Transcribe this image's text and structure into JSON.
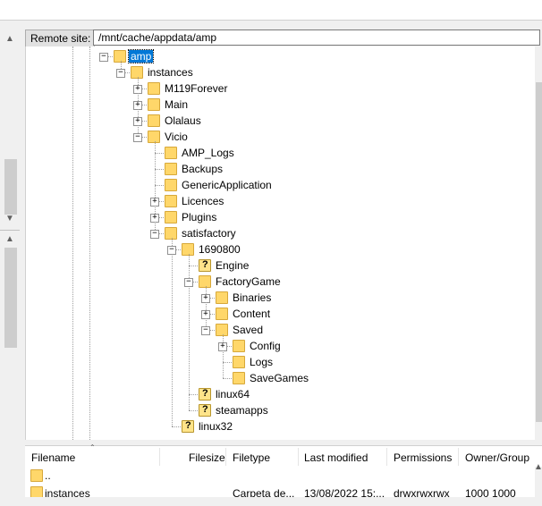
{
  "remote": {
    "label": "Remote site:",
    "path": "/mnt/cache/appdata/amp"
  },
  "tree": [
    {
      "label": "amp",
      "depth": 0,
      "exp": "-",
      "type": "folder",
      "selected": true
    },
    {
      "label": "instances",
      "depth": 1,
      "exp": "-",
      "type": "folder"
    },
    {
      "label": "M119Forever",
      "depth": 2,
      "exp": "+",
      "type": "folder"
    },
    {
      "label": "Main",
      "depth": 2,
      "exp": "+",
      "type": "folder"
    },
    {
      "label": "Olalaus",
      "depth": 2,
      "exp": "+",
      "type": "folder"
    },
    {
      "label": "Vicio",
      "depth": 2,
      "exp": "-",
      "type": "folder"
    },
    {
      "label": "AMP_Logs",
      "depth": 3,
      "exp": "",
      "type": "folder"
    },
    {
      "label": "Backups",
      "depth": 3,
      "exp": "",
      "type": "folder"
    },
    {
      "label": "GenericApplication",
      "depth": 3,
      "exp": "",
      "type": "folder"
    },
    {
      "label": "Licences",
      "depth": 3,
      "exp": "+",
      "type": "folder"
    },
    {
      "label": "Plugins",
      "depth": 3,
      "exp": "+",
      "type": "folder"
    },
    {
      "label": "satisfactory",
      "depth": 3,
      "exp": "-",
      "type": "folder"
    },
    {
      "label": "1690800",
      "depth": 4,
      "exp": "-",
      "type": "folder"
    },
    {
      "label": "Engine",
      "depth": 5,
      "exp": "",
      "type": "unknown"
    },
    {
      "label": "FactoryGame",
      "depth": 5,
      "exp": "-",
      "type": "folder"
    },
    {
      "label": "Binaries",
      "depth": 6,
      "exp": "+",
      "type": "folder"
    },
    {
      "label": "Content",
      "depth": 6,
      "exp": "+",
      "type": "folder"
    },
    {
      "label": "Saved",
      "depth": 6,
      "exp": "-",
      "type": "folder"
    },
    {
      "label": "Config",
      "depth": 7,
      "exp": "+",
      "type": "folder"
    },
    {
      "label": "Logs",
      "depth": 7,
      "exp": "",
      "type": "folder"
    },
    {
      "label": "SaveGames",
      "depth": 7,
      "exp": "",
      "type": "folder"
    },
    {
      "label": "linux64",
      "depth": 5,
      "exp": "",
      "type": "unknown"
    },
    {
      "label": "steamapps",
      "depth": 5,
      "exp": "",
      "type": "unknown"
    },
    {
      "label": "linux32",
      "depth": 4,
      "exp": "",
      "type": "unknown"
    }
  ],
  "files": {
    "columns": [
      "Filename",
      "Filesize",
      "Filetype",
      "Last modified",
      "Permissions",
      "Owner/Group"
    ],
    "rows": [
      {
        "name": "..",
        "size": "",
        "type": "",
        "modified": "",
        "perms": "",
        "owner": ""
      },
      {
        "name": "instances",
        "size": "",
        "type": "Carpeta de...",
        "modified": "13/08/2022 15:...",
        "perms": "drwxrwxrwx",
        "owner": "1000 1000"
      }
    ]
  }
}
